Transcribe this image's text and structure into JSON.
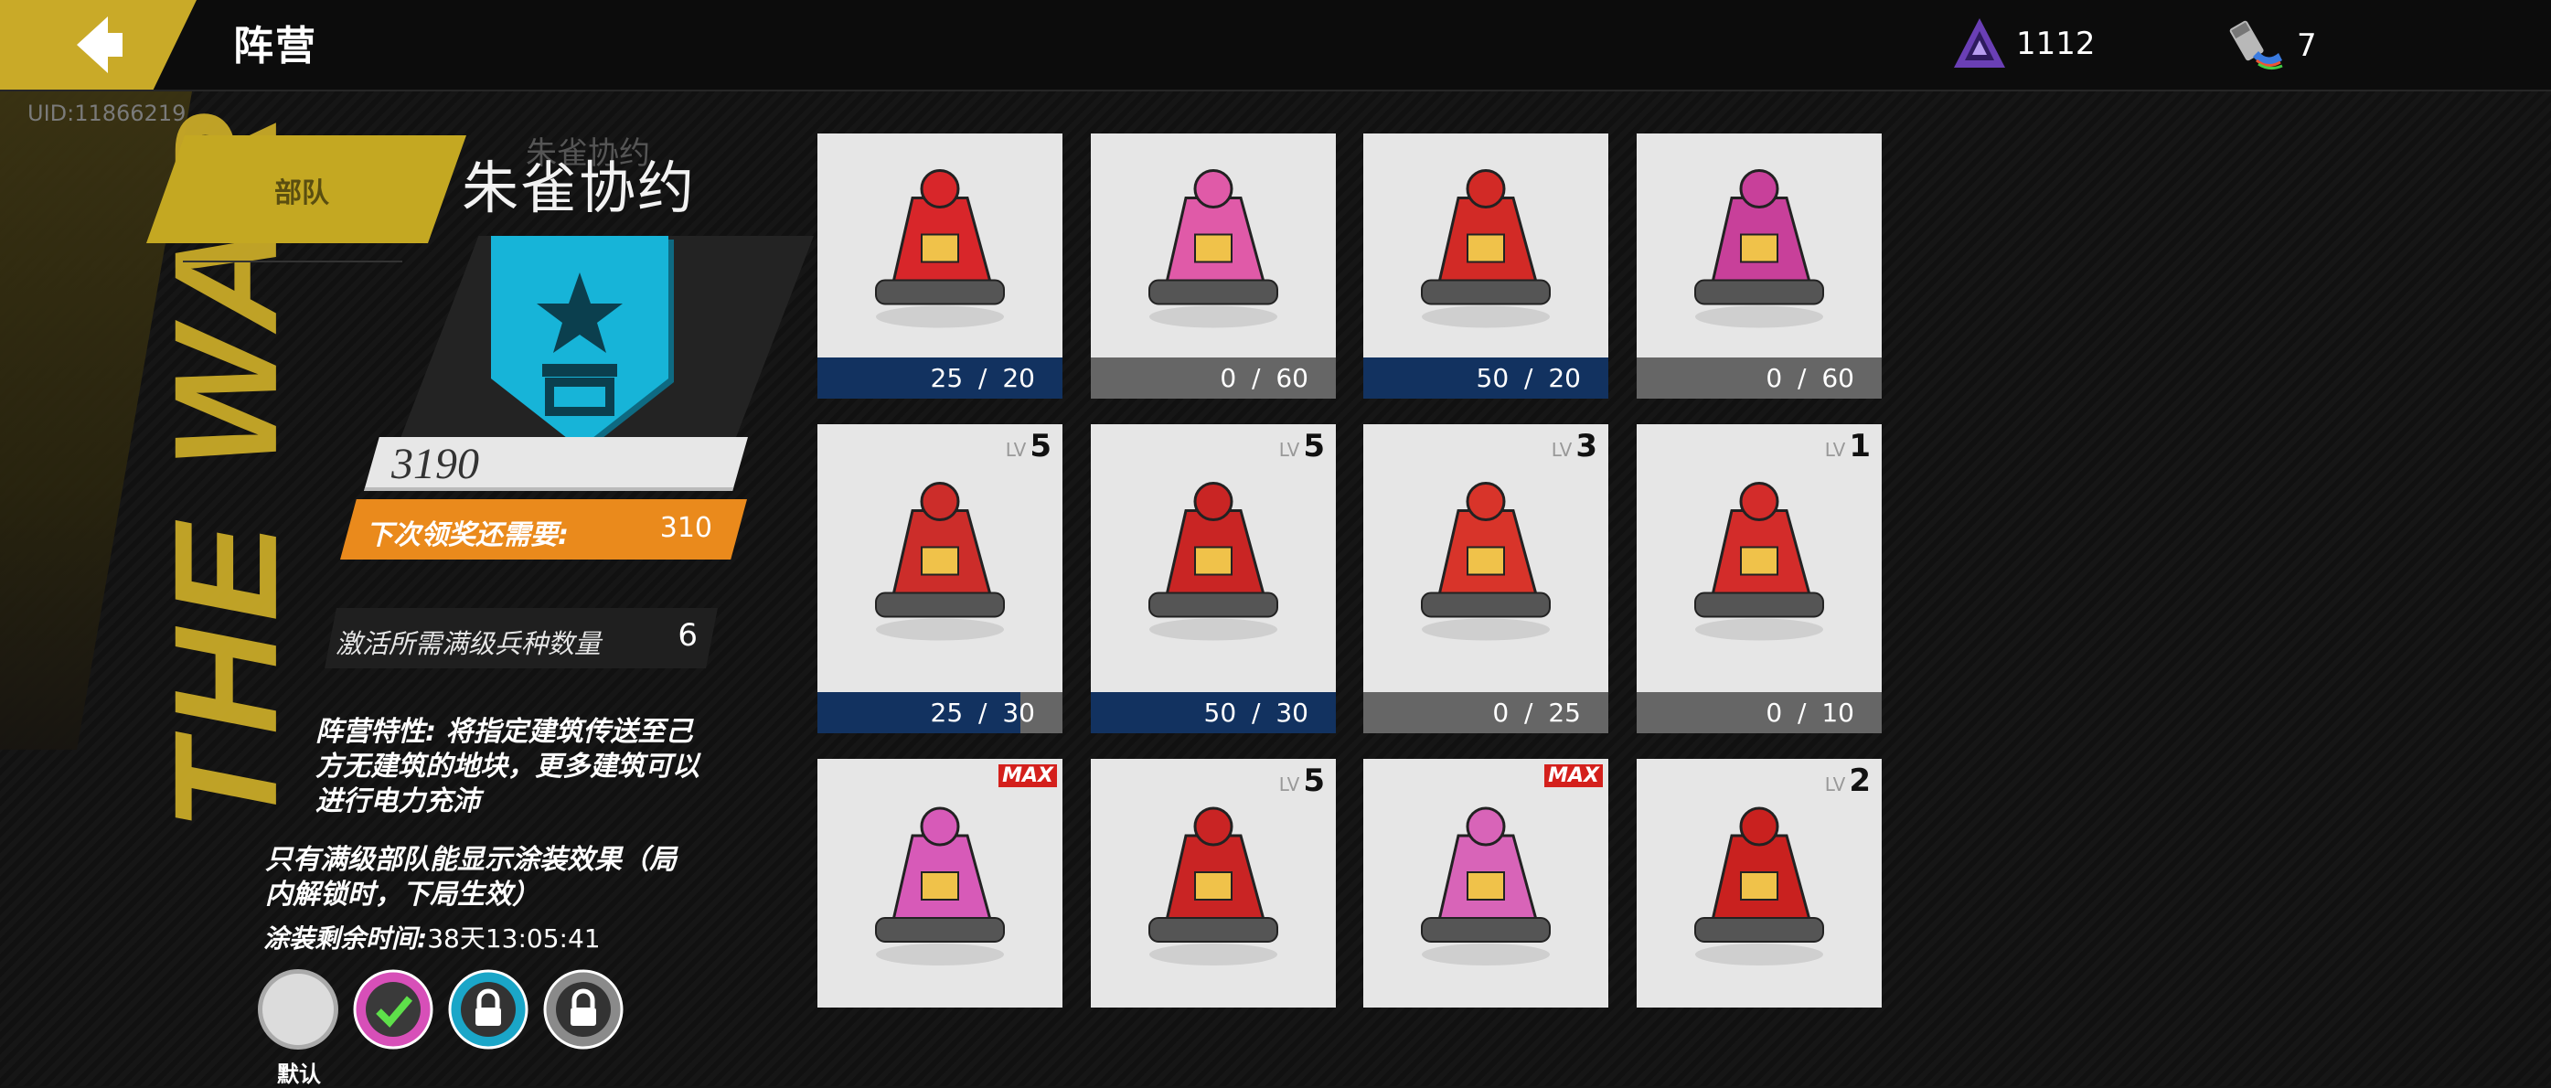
{
  "header": {
    "title": "阵营"
  },
  "currencies": [
    {
      "icon": "triangle-gem-icon",
      "value": "1112",
      "color": "#6a3fb5"
    },
    {
      "icon": "paint-tube-icon",
      "value": "7"
    }
  ],
  "uid": "UID:11866219",
  "faction": {
    "tab_label": "部队",
    "ghost_name": "朱雀协约",
    "name": "朱雀协约",
    "emblem_icon": "star-shield-emblem-icon",
    "emblem_color": "#17b4d8",
    "score": "3190",
    "reward_label": "下次领奖还需要:",
    "reward_value": "310",
    "requirement_label": "激活所需满级兵种数量",
    "requirement_value": "6",
    "trait": "阵营特性: 将指定建筑传送至己方无建筑的地块，更多建筑可以进行电力充沛",
    "note": "只有满级部队能显示涂装效果（局内解锁时，下局生效）",
    "timer_label": "涂装剩余时间:",
    "timer_value": "38天13:05:41",
    "skin_default_label": "默认"
  },
  "units": [
    {
      "name": "shield-rifle-mech",
      "progress": "25  /  20",
      "ratio": 1.0,
      "level": "",
      "max": false,
      "accent": "#d8262a"
    },
    {
      "name": "pink-pilot-girl",
      "progress": "0  /  60",
      "ratio": 0,
      "level": "",
      "max": false,
      "accent": "#e05aa8"
    },
    {
      "name": "cannon-arm-mech",
      "progress": "50  /  20",
      "ratio": 1.0,
      "level": "",
      "max": false,
      "accent": "#d22a26"
    },
    {
      "name": "winged-android",
      "progress": "0  /  60",
      "ratio": 0,
      "level": "",
      "max": false,
      "accent": "#c8409a"
    },
    {
      "name": "dome-tank",
      "progress": "25  /  30",
      "ratio": 0.83,
      "level": "5",
      "max": false,
      "accent": "#cc2d2a"
    },
    {
      "name": "missile-tank",
      "progress": "50  /  30",
      "ratio": 1.0,
      "level": "5",
      "max": false,
      "accent": "#c92524"
    },
    {
      "name": "heavy-robot",
      "progress": "0  /  25",
      "ratio": 0,
      "level": "3",
      "max": false,
      "accent": "#d8342a"
    },
    {
      "name": "stealth-jet",
      "progress": "0  /  10",
      "ratio": 0,
      "level": "1",
      "max": false,
      "accent": "#d32c2a"
    },
    {
      "name": "pink-fortress",
      "progress": "",
      "ratio": 0,
      "level": "",
      "max": true,
      "accent": "#d75ab8"
    },
    {
      "name": "red-beast-mech",
      "progress": "",
      "ratio": 0,
      "level": "5",
      "max": false,
      "accent": "#c92424"
    },
    {
      "name": "pink-blade-ship",
      "progress": "",
      "ratio": 0,
      "level": "",
      "max": true,
      "accent": "#d864b8"
    },
    {
      "name": "spear-knight-mech",
      "progress": "",
      "ratio": 0,
      "level": "2",
      "max": false,
      "accent": "#c9211f"
    }
  ],
  "labels": {
    "lv": "LV",
    "max": "MAX"
  }
}
